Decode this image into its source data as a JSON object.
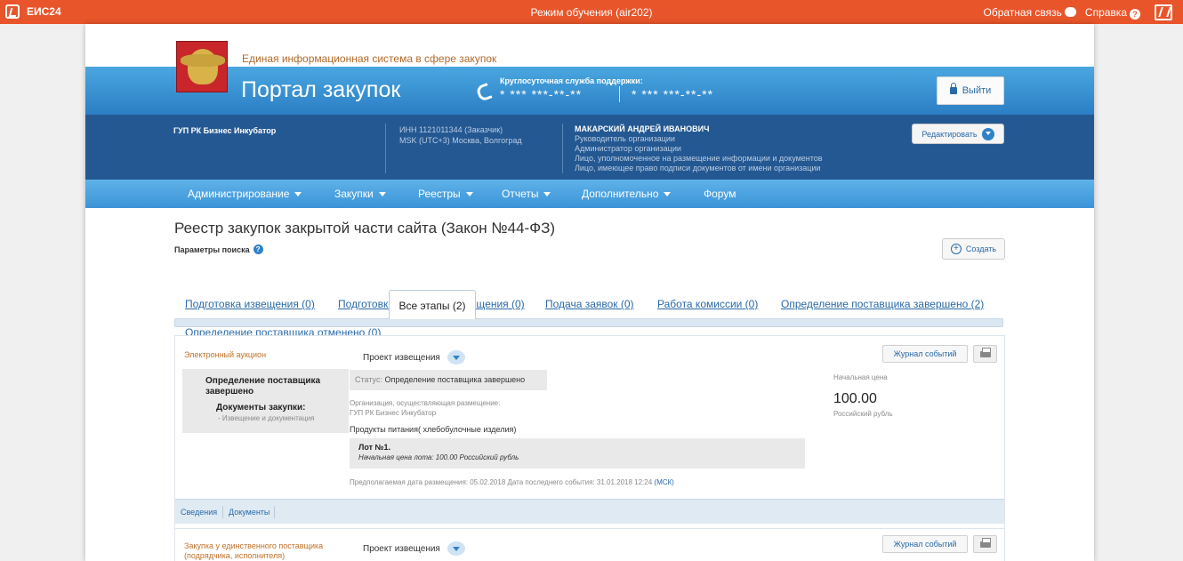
{
  "topbar": {
    "app_name": "ЕИС24",
    "mode": "Режим обучения (air202)",
    "feedback": "Обратная связь",
    "help": "Справка"
  },
  "header": {
    "system_name": "Единая информационная система в сфере закупок",
    "portal_title": "Портал закупок",
    "support_label": "Круглосуточная служба поддержки:",
    "phone1": "* *** ***-**-**",
    "phone2": "* *** ***-**-**",
    "logout": "Выйти"
  },
  "org": {
    "name": "ГУП РК Бизнес Инкубатор",
    "inn": "ИНН 1121011344 (Заказчик)",
    "timezone": "MSK (UTC+3) Москва, Волгоград",
    "person": "МАКАРСКИЙ АНДРЕЙ ИВАНОВИЧ",
    "roles": [
      "Руководитель организации",
      "Администратор организации",
      "Лицо, уполномоченное на размещение информации и документов",
      "Лицо, имеющее право подписи документов от имени организации"
    ],
    "edit": "Редактировать"
  },
  "nav": [
    {
      "label": "Администрирование",
      "dropdown": true
    },
    {
      "label": "Закупки",
      "dropdown": true
    },
    {
      "label": "Реестры",
      "dropdown": true
    },
    {
      "label": "Отчеты",
      "dropdown": true
    },
    {
      "label": "Дополнительно",
      "dropdown": true
    },
    {
      "label": "Форум",
      "dropdown": false
    }
  ],
  "registry": {
    "title": "Реестр закупок закрытой части сайта (Закон №44-ФЗ)",
    "search_params": "Параметры поиска",
    "create": "Создать"
  },
  "tabs": [
    "Подготовка извещения (0)",
    "Подготовка изменений извещения (0)",
    "Подача заявок (0)",
    "Работа комиссии (0)",
    "Определение поставщика завершено (2)",
    "Определение поставщика отменено (0)",
    "Все этапы (2)"
  ],
  "cards": [
    {
      "type": "Электронный аукцион",
      "draft": "Проект извещения",
      "journal": "Журнал событий",
      "stage": "Определение поставщика завершено",
      "docs_title": "Документы закупки:",
      "docs_link": "- Извещение и документация",
      "status_key": "Статус:",
      "status_value": "Определение поставщика завершено",
      "org_label": "Организация, осуществляющая размещение:",
      "org_value": "ГУП РК Бизнес Инкубатор",
      "product": "Продукты питания( хлебобулочные изделия)",
      "lot_title": "Лот №1.",
      "lot_price": "Начальная цена лота: 100.00 Российский рубль",
      "dates": "Предполагаемая дата размещения: 05.02.2018 Дата последнего события: 31.01.2018 12:24",
      "msk": "(МСК)",
      "price_label": "Начальная цена",
      "price_value": "100.00",
      "price_currency": "Российский рубль",
      "footer_tabs": [
        "Сведения",
        "Документы"
      ]
    },
    {
      "type": "Закупка у единственного поставщика (подрядчика, исполнителя)",
      "draft": "Проект извещения",
      "journal": "Журнал событий"
    }
  ]
}
